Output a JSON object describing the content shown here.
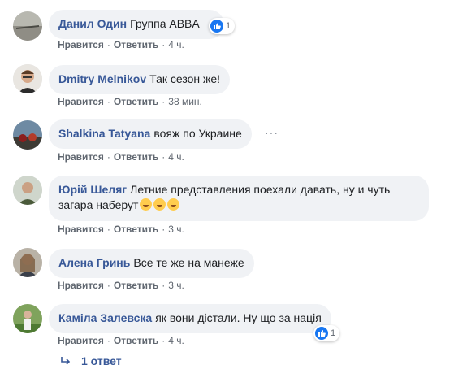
{
  "comments": [
    {
      "author": "Данил Один",
      "text": "Группа ABBA",
      "like": "Нравится",
      "reply": "Ответить",
      "time": "4 ч.",
      "reaction_count": "1"
    },
    {
      "author": "Dmitry Melnikov",
      "text": "Так сезон же!",
      "like": "Нравится",
      "reply": "Ответить",
      "time": "38 мин."
    },
    {
      "author": "Shalkina Tatyana",
      "text": "вояж по Украине",
      "like": "Нравится",
      "reply": "Ответить",
      "time": "4 ч.",
      "more": "···"
    },
    {
      "author": "Юрій Шеляг",
      "text_line1": "Летние представления поехали давать, ну и чуть",
      "text_line2": "загара наберут",
      "like": "Нравится",
      "reply": "Ответить",
      "time": "3 ч."
    },
    {
      "author": "Алена Гринь",
      "text": "Все те же на манеже",
      "like": "Нравится",
      "reply": "Ответить",
      "time": "3 ч."
    },
    {
      "author": "Каміла Залевска",
      "text": "як вони дістали. Ну що за нація",
      "like": "Нравится",
      "reply": "Ответить",
      "time": "4 ч.",
      "reaction_count": "1"
    }
  ],
  "separator": "·",
  "replies": {
    "label": "1 ответ"
  },
  "colors": {
    "link": "#385898",
    "bubble": "#f0f2f5",
    "like_blue": "#1877f2",
    "meta": "#606770"
  }
}
